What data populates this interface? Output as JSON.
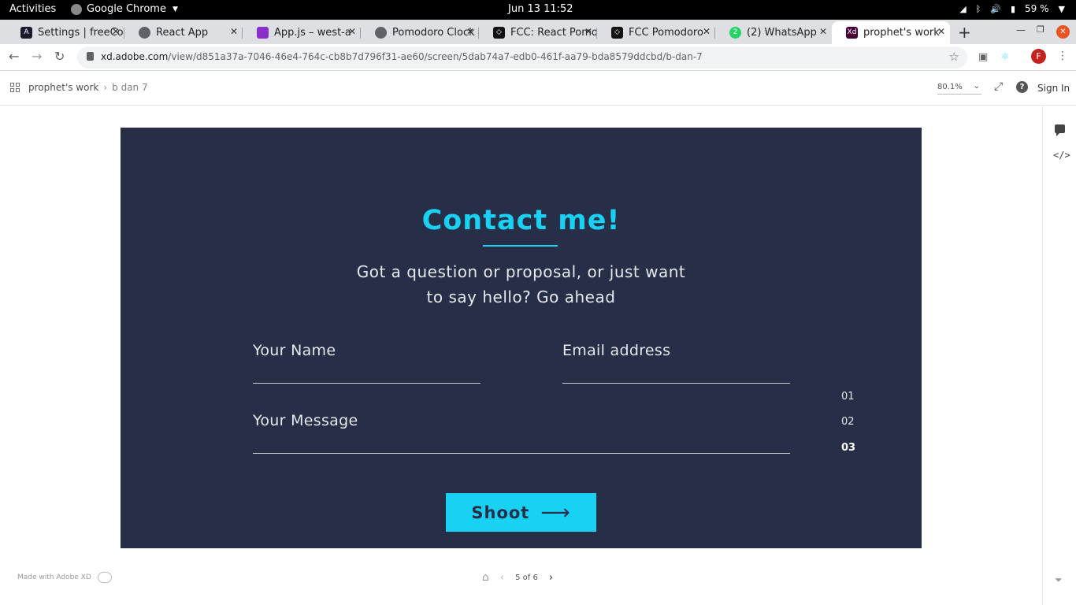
{
  "os": {
    "activities": "Activities",
    "app_name": "Google Chrome",
    "clock": "Jun 13  11:52",
    "battery": "59 %"
  },
  "tabs": [
    {
      "title": "Settings | freeCodeCamp",
      "favicon": "angular-icon",
      "color": "#1a1a2e"
    },
    {
      "title": "React App",
      "favicon": "globe-icon",
      "color": "#5f6368"
    },
    {
      "title": "App.js – west-a",
      "favicon": "stackblitz-icon",
      "color": "#8b2fc9"
    },
    {
      "title": "Pomodoro Clock",
      "favicon": "globe-icon",
      "color": "#5f6368"
    },
    {
      "title": "FCC: React Pomodoro",
      "favicon": "codepen-icon",
      "color": "#111111"
    },
    {
      "title": "FCC Pomodoro",
      "favicon": "codepen-icon",
      "color": "#111111"
    },
    {
      "title": "(2) WhatsApp",
      "favicon": "whatsapp-icon",
      "color": "#25d366"
    },
    {
      "title": "prophet's work",
      "favicon": "adobe-xd-icon",
      "color": "#470137",
      "active": true
    }
  ],
  "address": {
    "host": "xd.adobe.com",
    "path": "/view/d851a37a-7046-46e4-764c-cb8b7d796f31-ae60/screen/5dab74a7-edb0-461f-aa79-bda8579ddcbd/b-dan-7"
  },
  "profile_initial": "F",
  "viewer": {
    "project": "prophet's work",
    "screen": "b dan 7",
    "zoom": "80.1%",
    "sign_in": "Sign In",
    "made_with": "Made with Adobe XD",
    "page_indicator": "5 of 6"
  },
  "artboard": {
    "title": "Contact me!",
    "subtitle_line1": "Got a question or proposal, or just want",
    "subtitle_line2": "to say hello? Go ahead",
    "name_label": "Your Name",
    "email_label": "Email address",
    "message_label": "Your Message",
    "pager": [
      "01",
      "02",
      "03"
    ],
    "button_label": "Shoot",
    "button_arrow": "⟶"
  },
  "colors": {
    "artboard_bg": "#262f47",
    "accent": "#19d1f2",
    "text": "#e6e8ee"
  }
}
